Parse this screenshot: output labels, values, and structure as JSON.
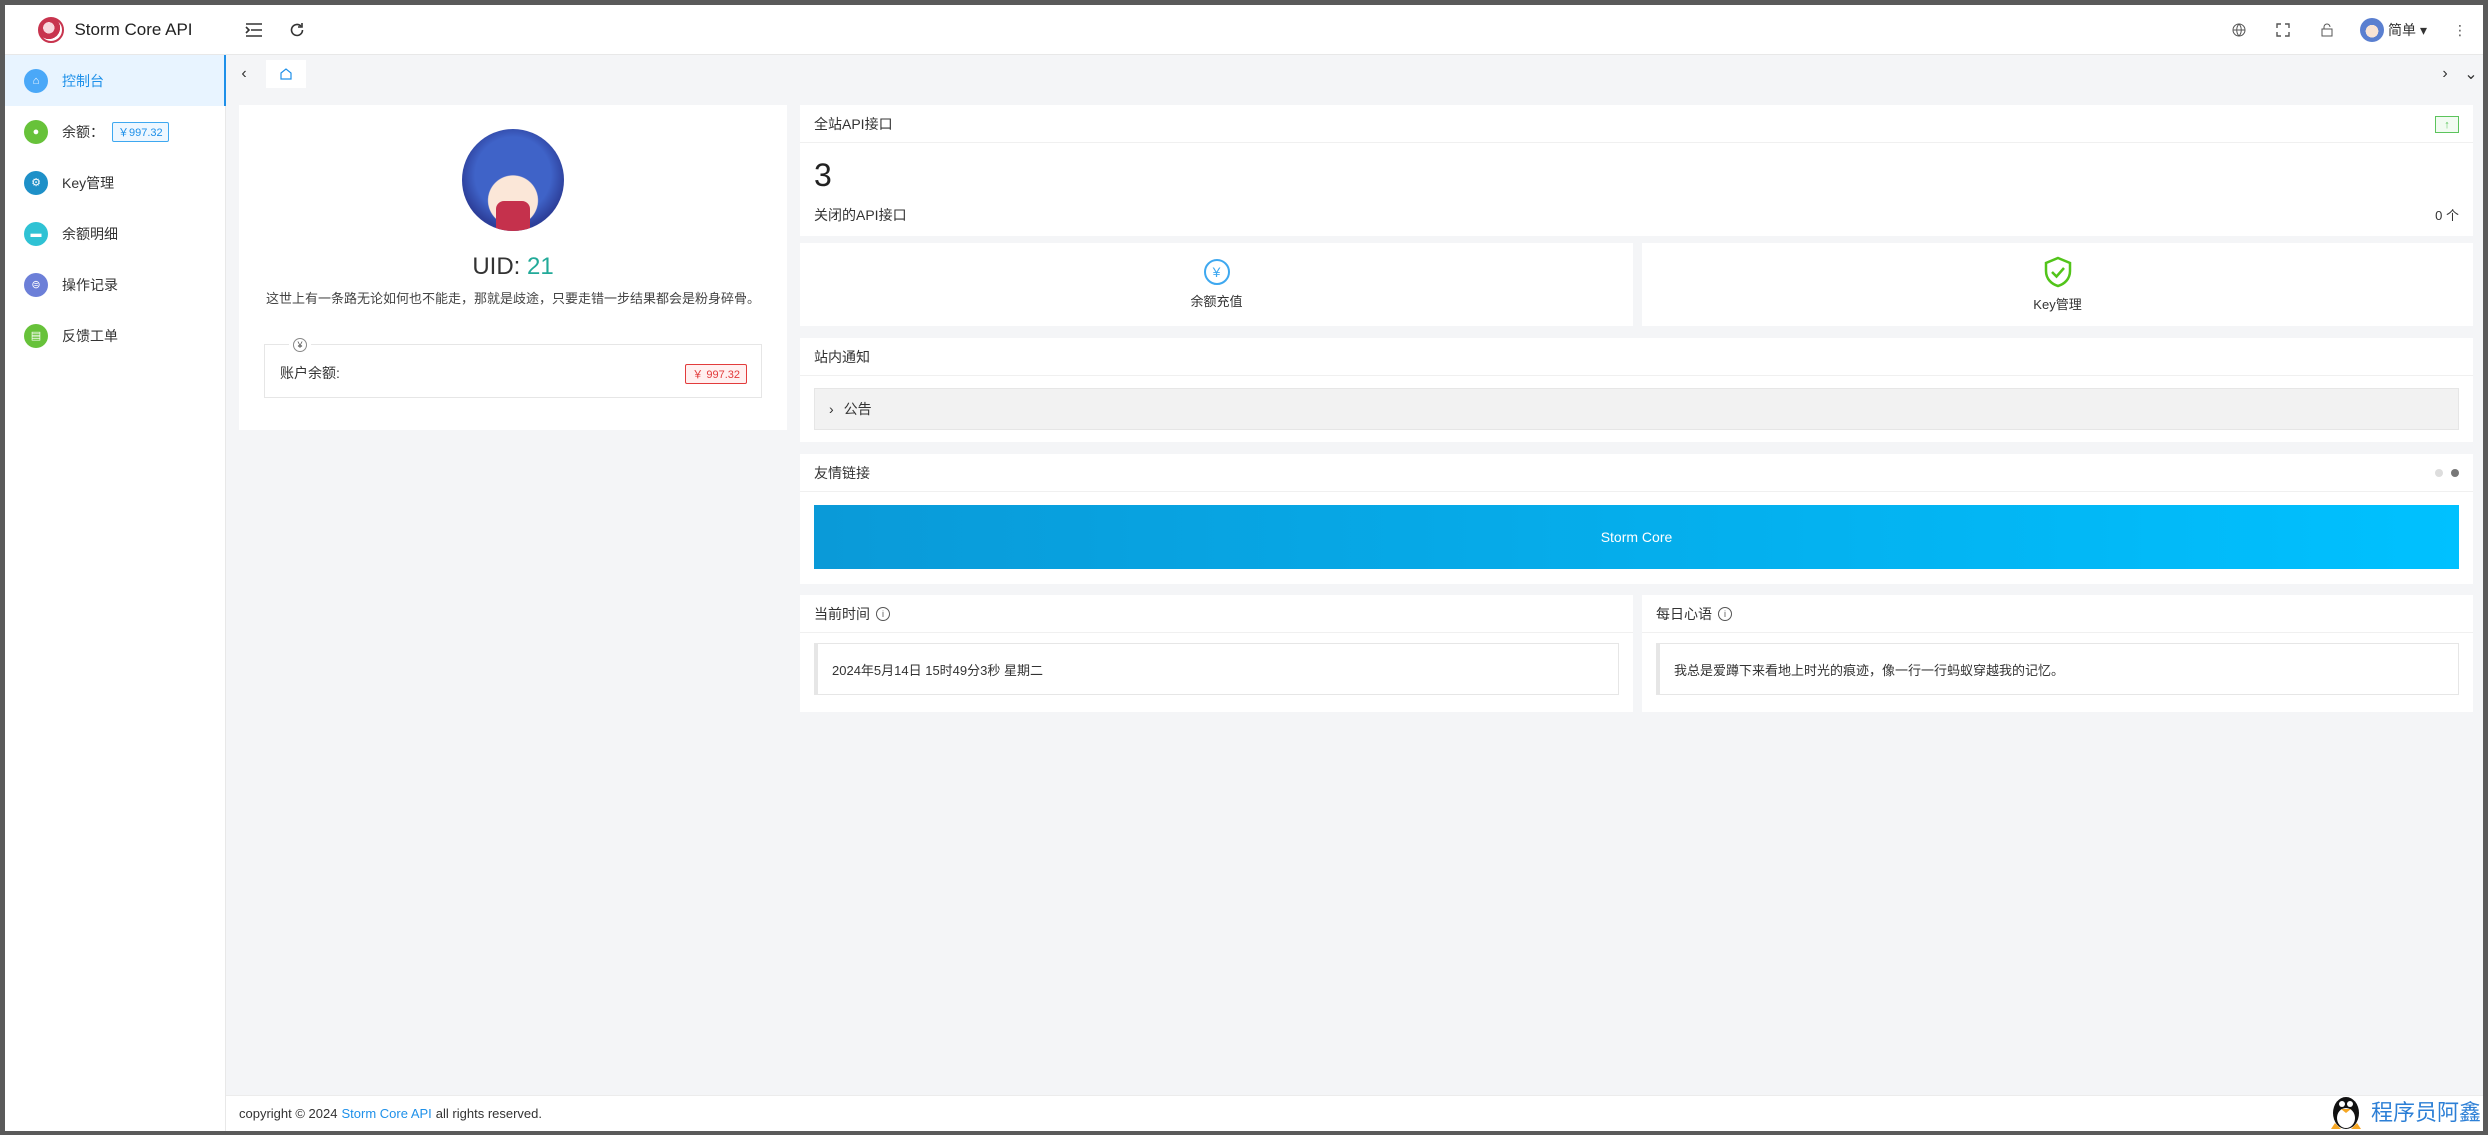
{
  "app": {
    "title": "Storm Core API"
  },
  "header": {
    "user_name": "简单"
  },
  "sidebar": {
    "items": [
      {
        "label": "控制台",
        "color": "#4aa8f8",
        "active": true
      },
      {
        "label": "余额：",
        "color": "#67c23a",
        "badge": "￥997.32"
      },
      {
        "label": "Key管理",
        "color": "#1e90c8"
      },
      {
        "label": "余额明细",
        "color": "#2fc2d4"
      },
      {
        "label": "操作记录",
        "color": "#6c7fd8"
      },
      {
        "label": "反馈工单",
        "color": "#67c23a"
      }
    ]
  },
  "profile": {
    "uid_label": "UID: ",
    "uid_value": "21",
    "motto": "这世上有一条路无论如何也不能走，那就是歧途，只要走错一步结果都会是粉身碎骨。",
    "balance_label": "账户余额:",
    "balance_value": "￥ 997.32"
  },
  "apis": {
    "title": "全站API接口",
    "count": "3",
    "closed_label": "关闭的API接口",
    "closed_value": "0 个"
  },
  "quick": {
    "recharge": "余额充值",
    "key_manage": "Key管理"
  },
  "notice": {
    "title": "站内通知",
    "item": "公告"
  },
  "links": {
    "title": "友情链接",
    "banner": "Storm Core"
  },
  "time": {
    "title": "当前时间",
    "value": "2024年5月14日 15时49分3秒 星期二"
  },
  "quote": {
    "title": "每日心语",
    "value": "我总是爱蹲下来看地上时光的痕迹，像一行一行蚂蚁穿越我的记忆。"
  },
  "footer": {
    "prefix": "copyright © 2024",
    "link": "Storm Core API",
    "suffix": "all rights reserved."
  },
  "watermark": {
    "text": "程序员阿鑫"
  }
}
